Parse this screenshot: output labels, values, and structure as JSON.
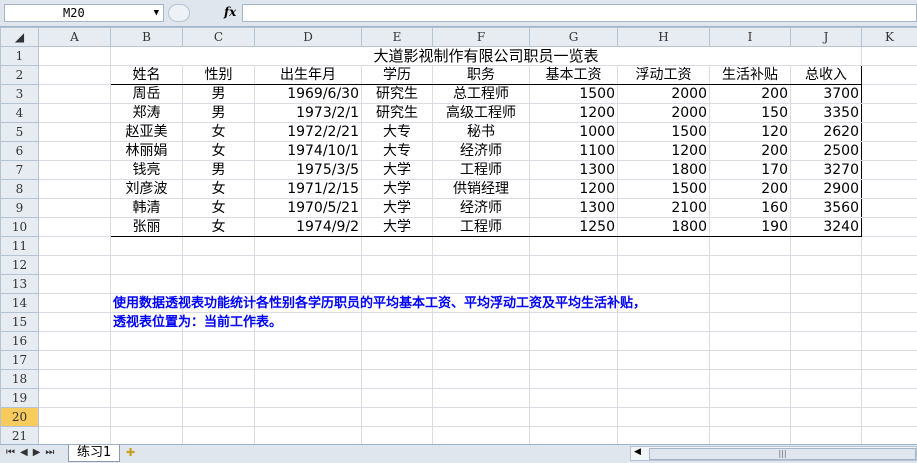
{
  "formula_bar": {
    "name_box": "M20",
    "fx": "fx",
    "formula": ""
  },
  "columns": [
    "A",
    "B",
    "C",
    "D",
    "E",
    "F",
    "G",
    "H",
    "I",
    "J",
    "K"
  ],
  "rows": [
    "1",
    "2",
    "3",
    "4",
    "5",
    "6",
    "7",
    "8",
    "9",
    "10",
    "11",
    "12",
    "13",
    "14",
    "15",
    "16",
    "17",
    "18",
    "19",
    "20",
    "21"
  ],
  "title": "大道影视制作有限公司职员一览表",
  "headers": [
    "姓名",
    "性别",
    "出生年月",
    "学历",
    "职务",
    "基本工资",
    "浮动工资",
    "生活补贴",
    "总收入"
  ],
  "records": [
    [
      "周岳",
      "男",
      "1969/6/30",
      "研究生",
      "总工程师",
      "1500",
      "2000",
      "200",
      "3700"
    ],
    [
      "郑涛",
      "男",
      "1973/2/1",
      "研究生",
      "高级工程师",
      "1200",
      "2000",
      "150",
      "3350"
    ],
    [
      "赵亚美",
      "女",
      "1972/2/21",
      "大专",
      "秘书",
      "1000",
      "1500",
      "120",
      "2620"
    ],
    [
      "林丽娟",
      "女",
      "1974/10/1",
      "大专",
      "经济师",
      "1100",
      "1200",
      "200",
      "2500"
    ],
    [
      "钱亮",
      "男",
      "1975/3/5",
      "大学",
      "工程师",
      "1300",
      "1800",
      "170",
      "3270"
    ],
    [
      "刘彦波",
      "女",
      "1971/2/15",
      "大学",
      "供销经理",
      "1200",
      "1500",
      "200",
      "2900"
    ],
    [
      "韩清",
      "女",
      "1970/5/21",
      "大学",
      "经济师",
      "1300",
      "2100",
      "160",
      "3560"
    ],
    [
      "张丽",
      "女",
      "1974/9/2",
      "大学",
      "工程师",
      "1250",
      "1800",
      "190",
      "3240"
    ]
  ],
  "instruction": [
    "使用数据透视表功能统计各性别各学历职员的平均基本工资、平均浮动工资及平均生活补贴，",
    "透视表位置为：当前工作表。"
  ],
  "sheet_tabs": [
    "练习1"
  ],
  "selected_row": "20"
}
